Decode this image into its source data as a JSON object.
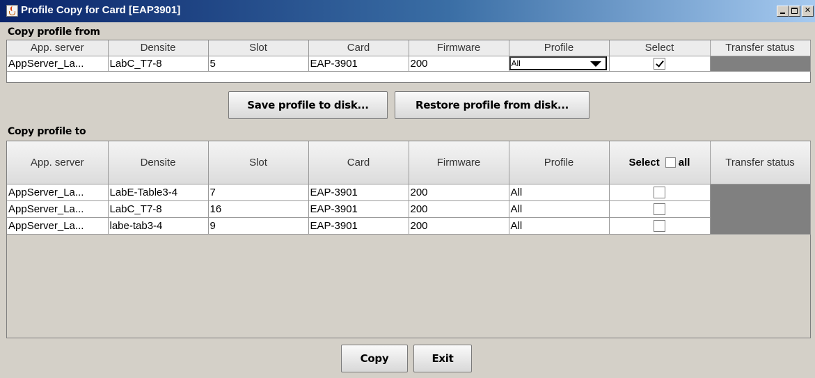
{
  "window": {
    "title": "Profile Copy for Card [EAP3901]"
  },
  "copy_from": {
    "label": "Copy profile from",
    "columns": [
      "App. server",
      "Densite",
      "Slot",
      "Card",
      "Firmware",
      "Profile",
      "Select",
      "Transfer status"
    ],
    "row": {
      "app_server": "AppServer_La...",
      "densite": "LabC_T7-8",
      "slot": "5",
      "card": "EAP-3901",
      "firmware": "200",
      "profile": "All",
      "selected": true,
      "transfer_status": ""
    }
  },
  "buttons": {
    "save": "Save profile to disk...",
    "restore": "Restore profile from disk...",
    "copy": "Copy",
    "exit": "Exit"
  },
  "copy_to": {
    "label": "Copy profile to",
    "columns": [
      "App. server",
      "Densite",
      "Slot",
      "Card",
      "Firmware",
      "Profile",
      "Select",
      "Transfer status"
    ],
    "select_all_label": "all",
    "rows": [
      {
        "app_server": "AppServer_La...",
        "densite": "LabE-Table3-4",
        "slot": "7",
        "card": "EAP-3901",
        "firmware": "200",
        "profile": "All",
        "selected": false
      },
      {
        "app_server": "AppServer_La...",
        "densite": "LabC_T7-8",
        "slot": "16",
        "card": "EAP-3901",
        "firmware": "200",
        "profile": "All",
        "selected": false
      },
      {
        "app_server": "AppServer_La...",
        "densite": "labe-tab3-4",
        "slot": "9",
        "card": "EAP-3901",
        "firmware": "200",
        "profile": "All",
        "selected": false
      }
    ]
  },
  "colors": {
    "title_gradient_start": "#0a246a",
    "title_gradient_end": "#a6caf0",
    "window_bg": "#d4d0c8",
    "transfer_status_cell": "#808080"
  }
}
